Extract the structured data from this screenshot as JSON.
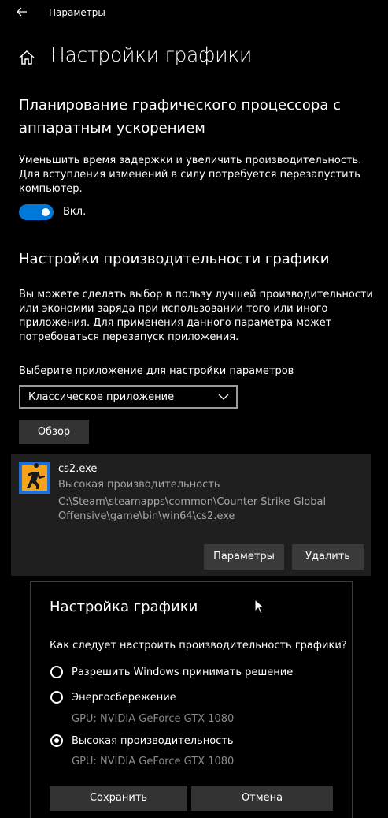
{
  "titlebar": {
    "title": "Параметры"
  },
  "page": {
    "title": "Настройки графики"
  },
  "gpu_scheduling": {
    "title": "Планирование графического процессора с аппаратным ускорением",
    "description": "Уменьшить время задержки и увеличить производительность. Для вступления изменений в силу потребуется перезапустить компьютер.",
    "toggle_state": "Вкл."
  },
  "perf_settings": {
    "title": "Настройки производительности графики",
    "description": "Вы можете сделать выбор в пользу лучшей производительности или экономии заряда при использовании того или иного приложения. Для применения данного параметра может потребоваться перезапуск приложения.",
    "select_label": "Выберите приложение для настройки параметров",
    "select_value": "Классическое приложение",
    "browse_label": "Обзор"
  },
  "app_entry": {
    "name": "cs2.exe",
    "preference": "Высокая производительность",
    "path": "C:\\Steam\\steamapps\\common\\Counter-Strike Global Offensive\\game\\bin\\win64\\cs2.exe",
    "options_label": "Параметры",
    "remove_label": "Удалить"
  },
  "dialog": {
    "title": "Настройка графики",
    "question": "Как следует настроить производительность графики?",
    "options": [
      {
        "label": "Разрешить Windows принимать решение",
        "gpu": "",
        "selected": false
      },
      {
        "label": "Энергосбережение",
        "gpu": "GPU: NVIDIA GeForce GTX 1080",
        "selected": false
      },
      {
        "label": "Высокая производительность",
        "gpu": "GPU: NVIDIA GeForce GTX 1080",
        "selected": true
      }
    ],
    "save_label": "Сохранить",
    "cancel_label": "Отмена"
  },
  "colors": {
    "accent": "#0078d7",
    "card": "#1f1f1f",
    "button": "#333333"
  }
}
